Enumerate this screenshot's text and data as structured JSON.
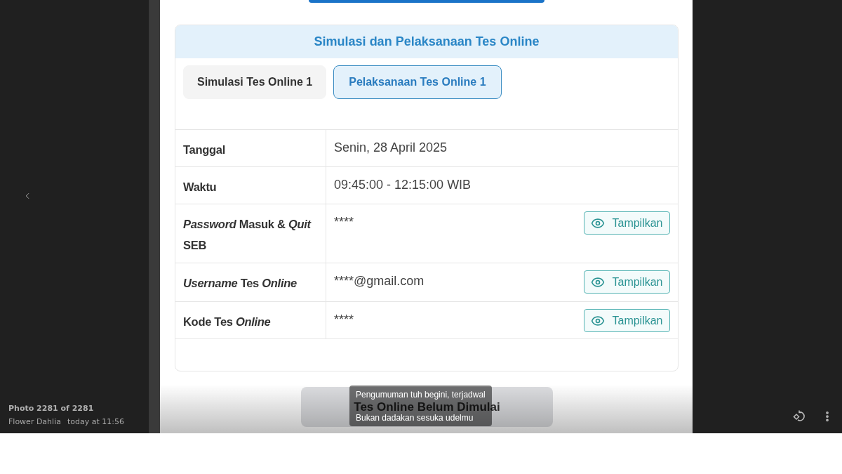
{
  "page": {
    "section_title": "Simulasi dan Pelaksanaan Tes Online",
    "tabs": [
      {
        "label": "Simulasi Tes Online 1",
        "selected": false
      },
      {
        "label": "Pelaksanaan Tes Online 1",
        "selected": true
      }
    ],
    "rows": [
      {
        "label": "Tanggal",
        "value": "Senin, 28 April 2025"
      },
      {
        "label": "Waktu",
        "value": "09:45:00 - 12:15:00 WIB"
      },
      {
        "label": "*Password* Masuk & *Quit* SEB",
        "value": "****",
        "button": "Tampilkan"
      },
      {
        "label": "*Username* Tes *Online*",
        "value": "****@gmail.com",
        "button": "Tampilkan"
      },
      {
        "label": "Kode Tes *Online*",
        "value": "****",
        "button": "Tampilkan"
      }
    ],
    "status_button": {
      "label": "Tes Online Belum Dimulai",
      "disabled": true
    }
  },
  "viewer": {
    "counter": "Photo 2281 of 2281",
    "sender": "Flower Dahlia",
    "time": "today at 11:56",
    "caption": [
      "Pengumuman tuh begini, terjadwal",
      "Bukan dadakan sesuka udelmu"
    ]
  }
}
